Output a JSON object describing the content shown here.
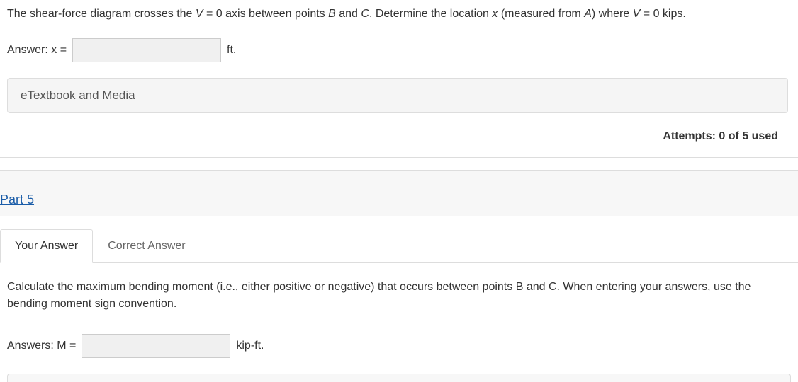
{
  "part4": {
    "question_prefix": "The shear-force diagram crosses the ",
    "question_var1": "V",
    "question_mid1": " = 0 axis between points ",
    "question_var2": "B",
    "question_mid2": " and ",
    "question_var3": "C",
    "question_mid3": ". Determine the location ",
    "question_var4": "x",
    "question_mid4": " (measured from ",
    "question_var5": "A",
    "question_mid5": ") where ",
    "question_var6": "V",
    "question_suffix": " = 0 kips.",
    "answer_label": "Answer: x =",
    "answer_value": "",
    "answer_unit": "ft.",
    "etextbook_label": "eTextbook and Media",
    "attempts_text": "Attempts: 0 of 5 used"
  },
  "part5": {
    "header": "Part 5",
    "tabs": {
      "your_answer": "Your Answer",
      "correct_answer": "Correct Answer"
    },
    "question_prefix": "Calculate the maximum bending moment (i.e., either positive or negative) that occurs between points ",
    "question_var1": "B",
    "question_mid1": " and ",
    "question_var2": "C",
    "question_suffix": ". When entering your answers, use the bending moment sign convention.",
    "answer_label": "Answers: M =",
    "answer_value": "",
    "answer_unit": "kip-ft."
  }
}
